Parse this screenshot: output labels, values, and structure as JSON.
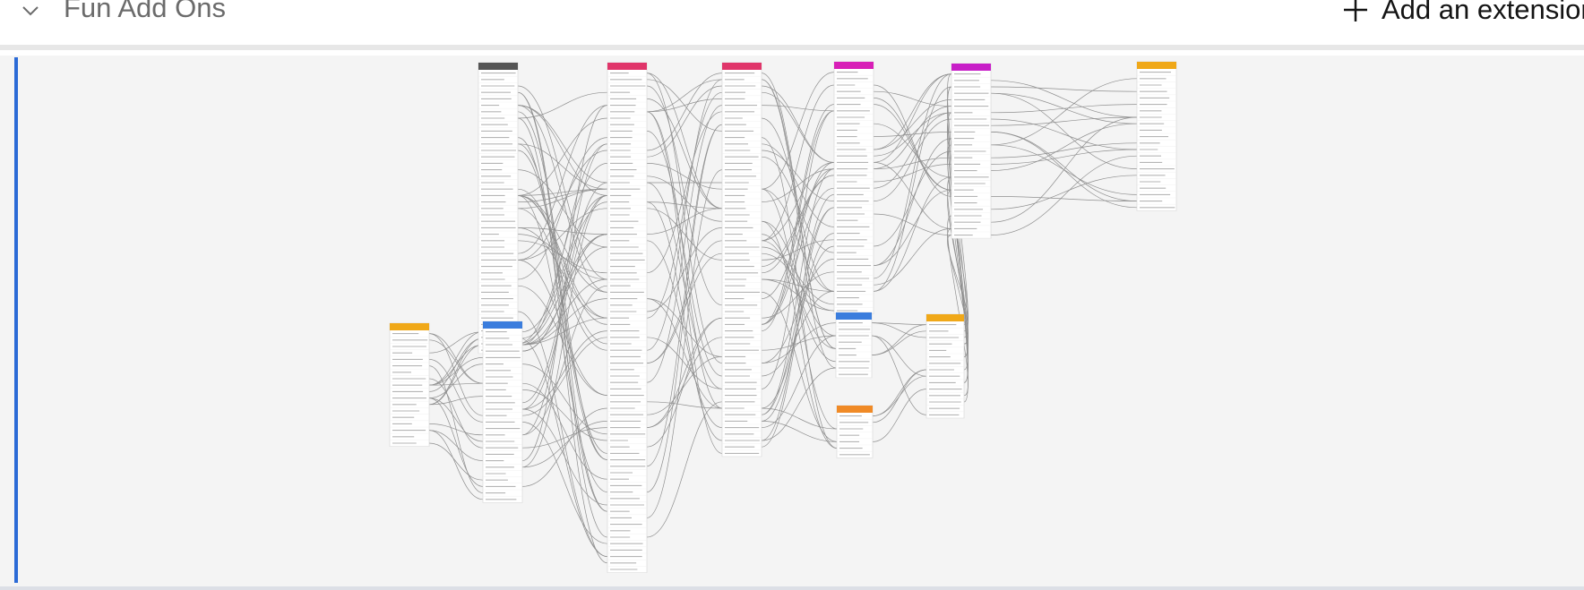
{
  "header": {
    "title": "Fun Add Ons",
    "add_extension_label": "Add an extension",
    "icons": {
      "collapse": "chevron-down-icon",
      "add": "plus-icon"
    }
  },
  "colors": {
    "accent": "#2b6ad6",
    "link": "#8f8f8f"
  },
  "diagram": {
    "tables": [
      {
        "id": "t1",
        "color": "#555555",
        "rows": 44
      },
      {
        "id": "t2",
        "color": "#e0356a",
        "rows": 78
      },
      {
        "id": "t3",
        "color": "#e0356a",
        "rows": 60
      },
      {
        "id": "t4",
        "color": "#d81fb7",
        "rows": 38
      },
      {
        "id": "t5",
        "color": "#c81fc8",
        "rows": 26
      },
      {
        "id": "t6",
        "color": "#f0a818",
        "rows": 22
      },
      {
        "id": "t7",
        "color": "#f0a818",
        "rows": 18
      },
      {
        "id": "t8",
        "color": "#3b7ddd",
        "rows": 27
      },
      {
        "id": "t9",
        "color": "#3b7ddd",
        "rows": 9
      },
      {
        "id": "t10",
        "color": "#f08a26",
        "rows": 7
      },
      {
        "id": "t11",
        "color": "#f0a818",
        "rows": 15
      }
    ]
  }
}
